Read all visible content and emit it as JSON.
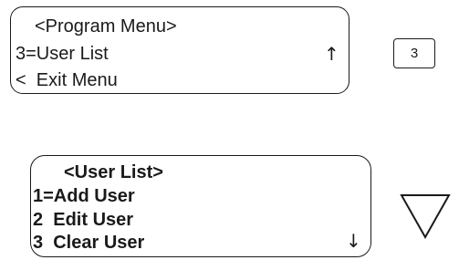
{
  "program_menu": {
    "title": "<Program Menu>",
    "line1": "3=User List",
    "line1_arrow": "↑",
    "line2": "<  Exit Menu"
  },
  "key": {
    "label": "3"
  },
  "user_list": {
    "title": "<User List>",
    "items": [
      "1=Add User",
      "2  Edit User",
      "3  Clear User"
    ],
    "scroll_arrow": "↓"
  },
  "icons": {
    "down_button": "down-triangle-icon"
  }
}
